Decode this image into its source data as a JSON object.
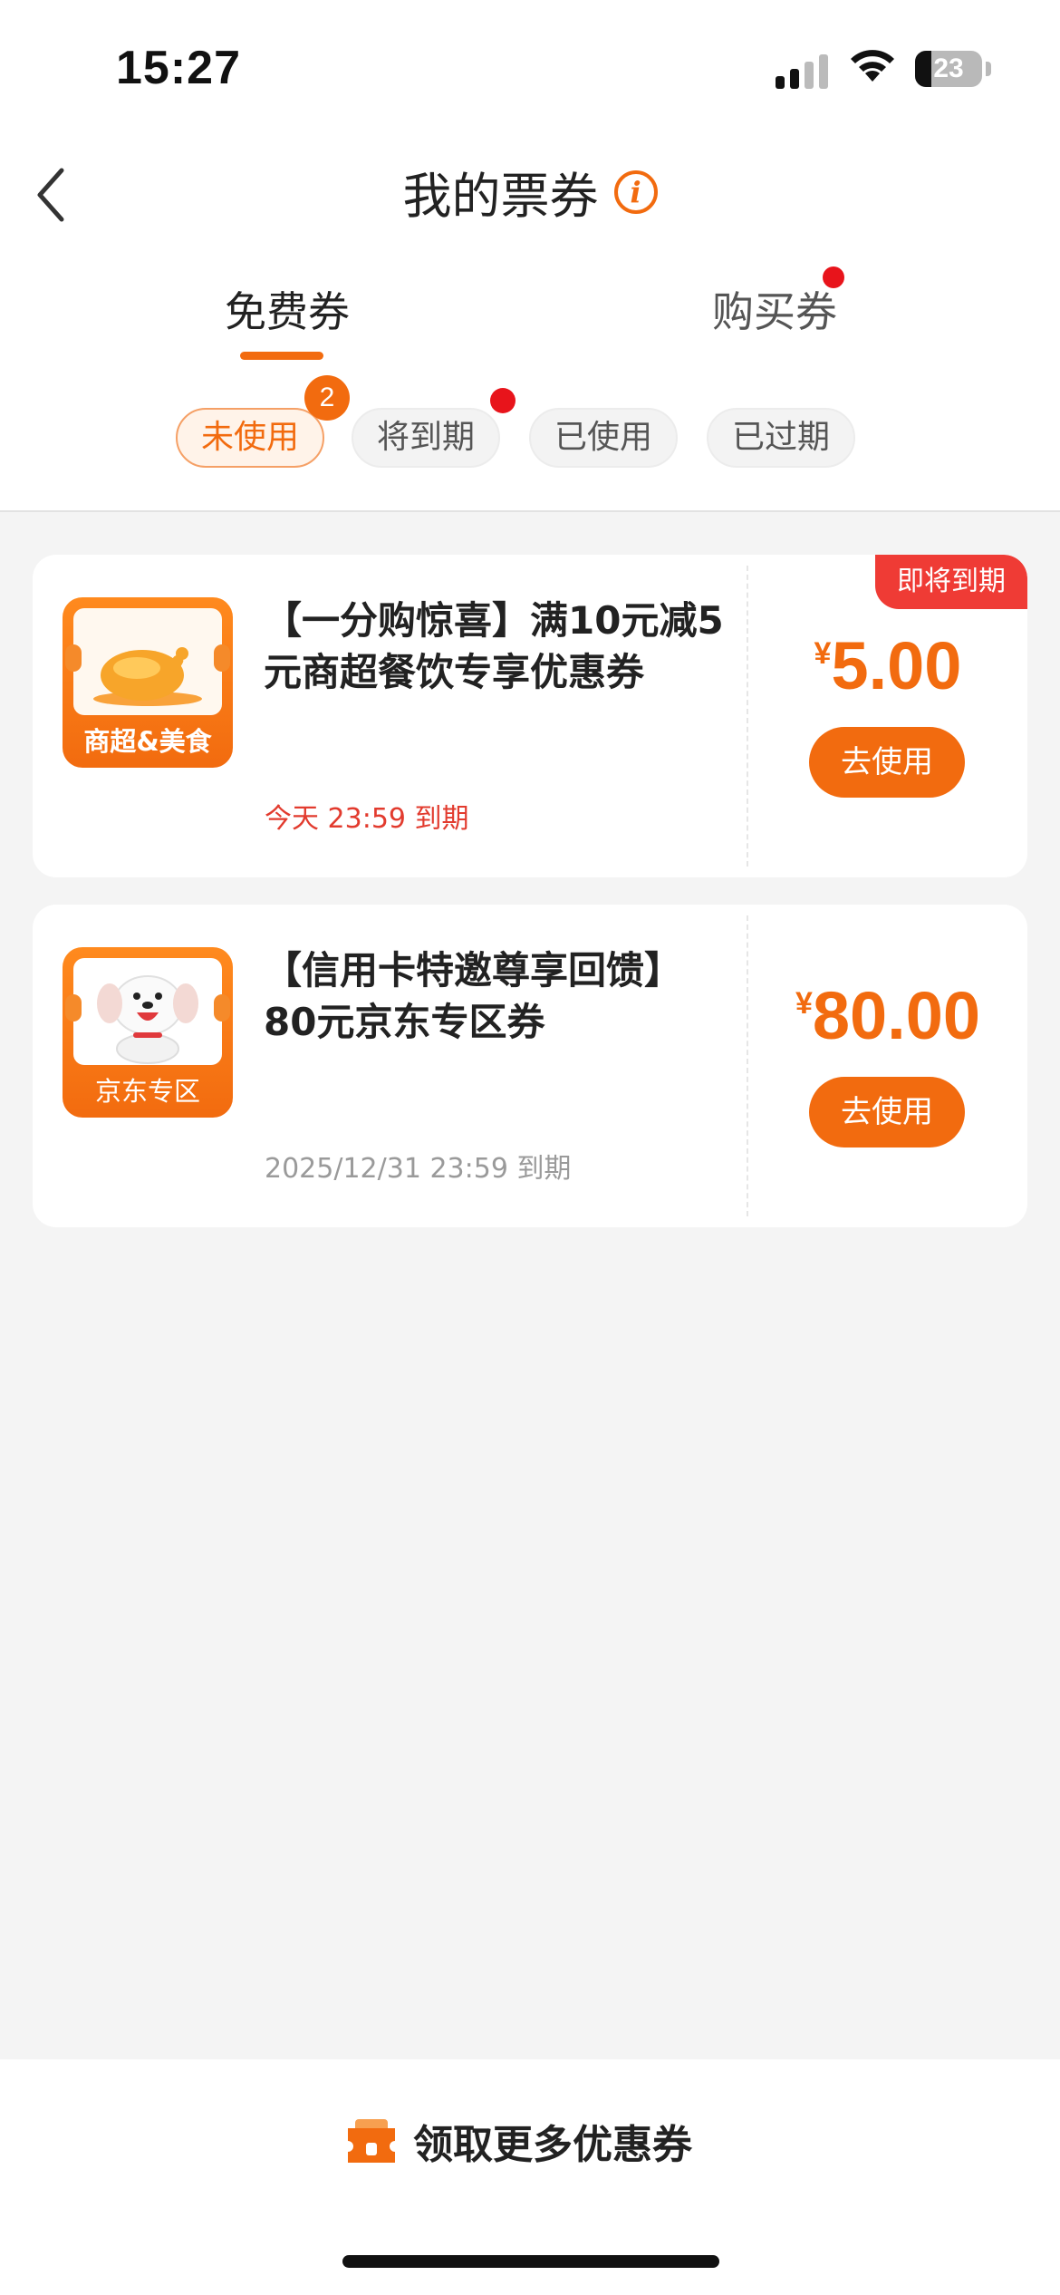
{
  "status_bar": {
    "time": "15:27",
    "battery": "23"
  },
  "header": {
    "title": "我的票券"
  },
  "tabs": [
    {
      "label": "免费券",
      "active": true
    },
    {
      "label": "购买券",
      "active": false,
      "has_dot": true
    }
  ],
  "filters": [
    {
      "label": "未使用",
      "active": true,
      "badge": "2"
    },
    {
      "label": "将到期",
      "active": false,
      "has_dot": true
    },
    {
      "label": "已使用",
      "active": false
    },
    {
      "label": "已过期",
      "active": false
    }
  ],
  "coupons": [
    {
      "icon": "food-coupon-icon",
      "icon_label": "商超&美食",
      "title": "【一分购惊喜】满10元减5元商超餐饮专享优惠券",
      "expire": "今天 23:59 到期",
      "currency": "¥",
      "amount": "5.00",
      "button": "去使用",
      "tag": "即将到期"
    },
    {
      "icon": "jd-mascot-icon",
      "icon_label": "京东专区",
      "title": "【信用卡特邀尊享回馈】80元京东专区券",
      "expire": "2025/12/31 23:59 到期",
      "currency": "¥",
      "amount": "80.00",
      "button": "去使用"
    }
  ],
  "bottom": {
    "label": "领取更多优惠券"
  },
  "colors": {
    "accent": "#f26b0f",
    "alert": "#e8141b",
    "tag": "#ef3b35"
  }
}
